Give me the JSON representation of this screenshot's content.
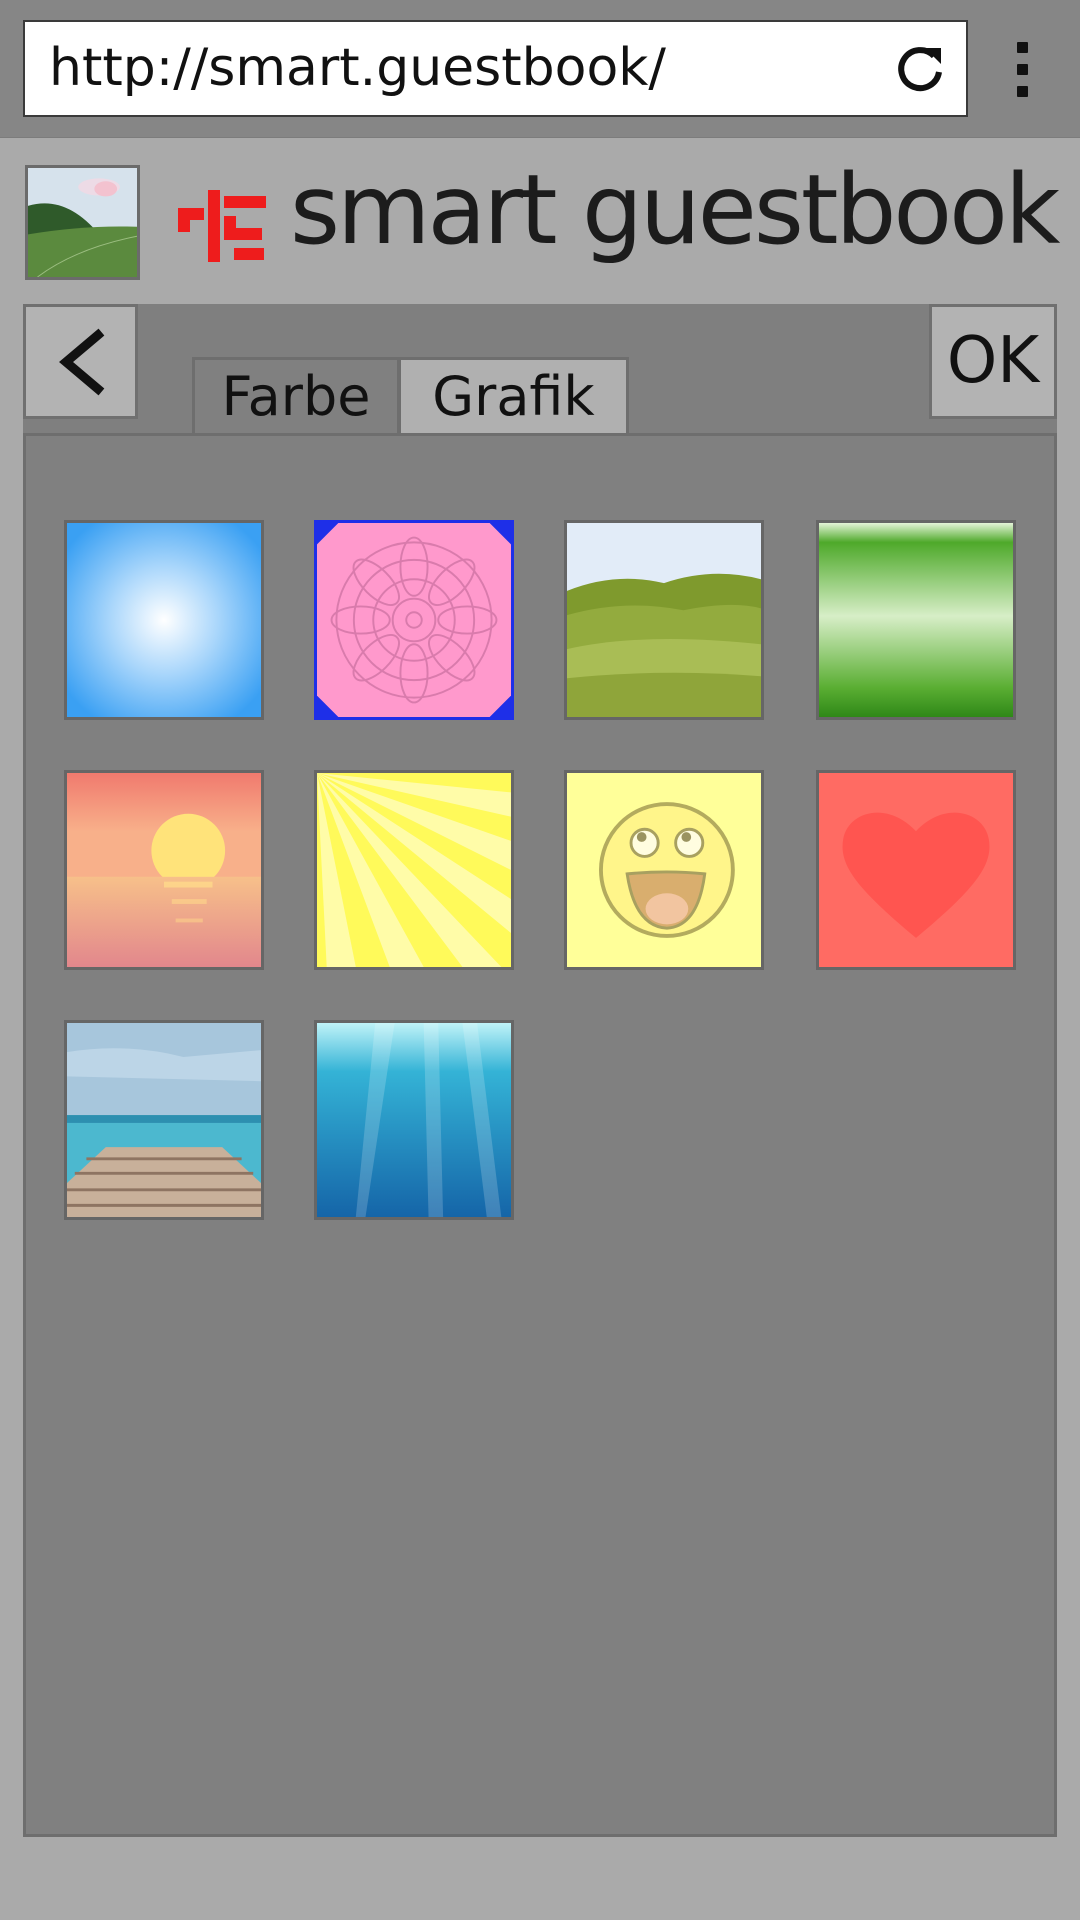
{
  "browser": {
    "url": "http://smart.guestbook/",
    "reload_icon": "reload-icon",
    "menu_icon": "kebab-menu-icon"
  },
  "header": {
    "avatar_icon": "landscape-thumbnail",
    "logo_icon": "smart-guestbook-logo",
    "title": "smart guestbook"
  },
  "toolbar": {
    "back_icon": "chevron-left-icon",
    "ok_label": "OK"
  },
  "tabs": [
    {
      "label": "Farbe",
      "active": false
    },
    {
      "label": "Grafik",
      "active": true
    }
  ],
  "graphics": [
    {
      "name": "blue-radial-gradient",
      "selected": false
    },
    {
      "name": "pink-mandala",
      "selected": true
    },
    {
      "name": "green-hills",
      "selected": false
    },
    {
      "name": "green-gradient",
      "selected": false
    },
    {
      "name": "sunset-sea",
      "selected": false
    },
    {
      "name": "yellow-sunburst",
      "selected": false
    },
    {
      "name": "smiley-face",
      "selected": false
    },
    {
      "name": "red-heart",
      "selected": false
    },
    {
      "name": "wooden-pier",
      "selected": false
    },
    {
      "name": "underwater",
      "selected": false
    }
  ],
  "colors": {
    "selection_border": "#1e2fe8",
    "logo_red": "#ee1c1c",
    "page_bg": "#aaaaaa",
    "panel_bg": "#808080"
  }
}
